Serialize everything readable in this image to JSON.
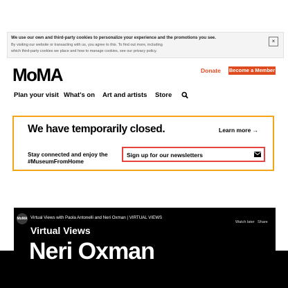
{
  "cookie_banner": {
    "text": "We use our own and third-party cookies to personalize your experience and the promotions you see.",
    "sub_line_1": "By visiting our website or transacting with us, you agree to this. To find out more, including",
    "sub_line_2": "which third-party cookies we place and how to manage cookies, see our privacy policy.",
    "close_symbol": "×"
  },
  "header": {
    "logo": "MoMA",
    "donate": "Donate",
    "member": "Become a Member",
    "nav": [
      "Plan your visit",
      "What's on",
      "Art and artists",
      "Store"
    ]
  },
  "closed_notice": {
    "title": "We have temporarily closed.",
    "learn_more": "Learn more →",
    "stay": "Stay connected and enjoy the #MuseumFromHome",
    "signup": "Sign up for our newsletters"
  },
  "video": {
    "avatar": "MoMA",
    "caption": "Virtual Views with Paola Antonelli and Neri Oxman | VIRTUAL VIEWS",
    "watch_later": "Watch later",
    "share": "Share",
    "heading": "Virtual Views",
    "title": "Neri Oxman"
  },
  "colors": {
    "accent": "#e04a1f",
    "highlight": "#f3a515",
    "signup_border": "#e8423c"
  }
}
